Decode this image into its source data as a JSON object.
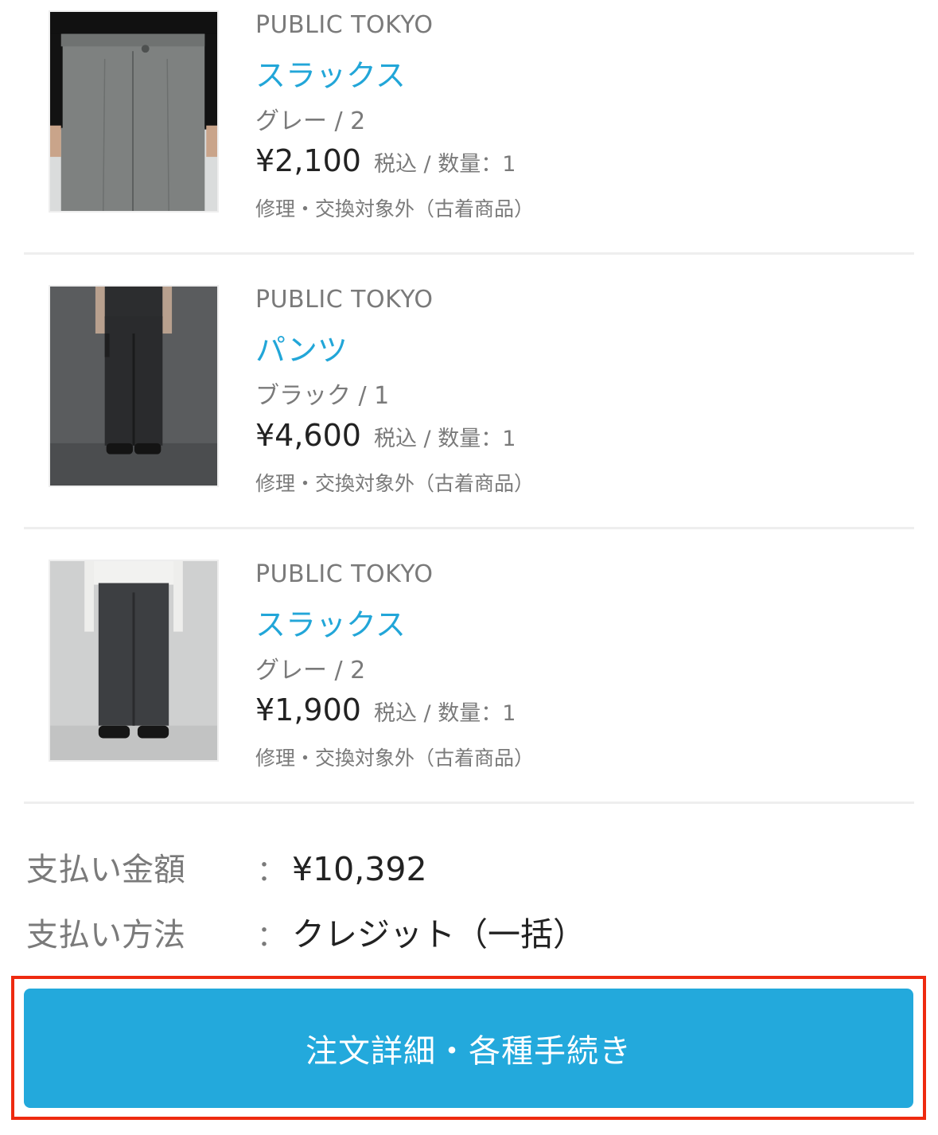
{
  "items": [
    {
      "brand": "PUBLIC TOKYO",
      "name": "スラックス",
      "variant": "グレー / 2",
      "price": "¥2,100",
      "price_meta": "税込 / 数量：1",
      "note": "修理・交換対象外（古着商品）"
    },
    {
      "brand": "PUBLIC TOKYO",
      "name": "パンツ",
      "variant": "ブラック / 1",
      "price": "¥4,600",
      "price_meta": "税込 / 数量：1",
      "note": "修理・交換対象外（古着商品）"
    },
    {
      "brand": "PUBLIC TOKYO",
      "name": "スラックス",
      "variant": "グレー / 2",
      "price": "¥1,900",
      "price_meta": "税込 / 数量：1",
      "note": "修理・交換対象外（古着商品）"
    }
  ],
  "summary": {
    "amount_label": "支払い金額",
    "amount_value": "¥10,392",
    "method_label": "支払い方法",
    "method_value": "クレジット（一括）",
    "colon": "："
  },
  "cta": {
    "label": "注文詳細・各種手続き"
  },
  "colors": {
    "accent": "#22a6d8",
    "button": "#23a9dc",
    "highlight_border": "#ee2a10"
  }
}
